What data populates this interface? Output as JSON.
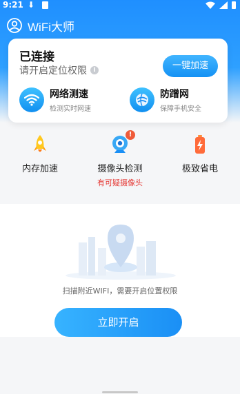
{
  "status_bar": {
    "time": "9:21"
  },
  "app": {
    "title": "WiFi大师"
  },
  "connection_card": {
    "status": "已连接",
    "hint": "请开启定位权限",
    "speed_button": "一键加速",
    "features": [
      {
        "title": "网络测速",
        "subtitle": "检测实时网速",
        "icon": "wifi-icon"
      },
      {
        "title": "防蹭网",
        "subtitle": "保障手机安全",
        "icon": "shield-globe-icon"
      }
    ]
  },
  "tools": [
    {
      "label": "内存加速",
      "icon": "rocket-icon",
      "sub": ""
    },
    {
      "label": "摄像头检测",
      "icon": "camera-icon",
      "sub": "有可疑摄像头",
      "badge": "!"
    },
    {
      "label": "极致省电",
      "icon": "battery-icon",
      "sub": ""
    }
  ],
  "empty_state": {
    "message": "扫描附近WIFI，需要开启位置权限",
    "button": "立即开启"
  },
  "colors": {
    "primary": "#1f8fff",
    "alert": "#e53935",
    "badge": "#ef5b3a"
  }
}
